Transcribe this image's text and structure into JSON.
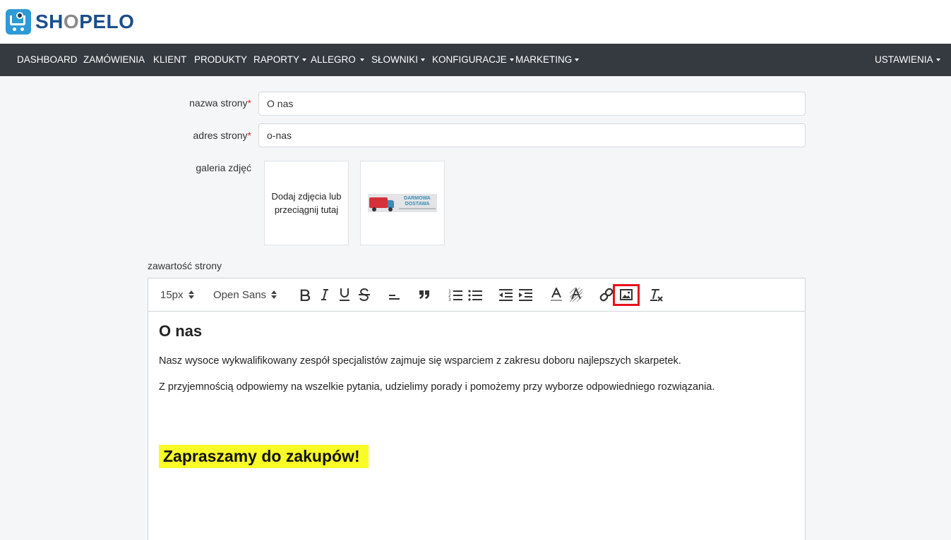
{
  "brand": {
    "name_pre": "SH",
    "name_o": "O",
    "name_post": "PELO"
  },
  "nav": {
    "items": [
      {
        "label": "DASHBOARD",
        "dropdown": false
      },
      {
        "label": "ZAMÓWIENIA",
        "dropdown": false
      },
      {
        "label": "KLIENT",
        "dropdown": false
      },
      {
        "label": "PRODUKTY",
        "dropdown": false
      },
      {
        "label": "RAPORTY",
        "dropdown": true
      },
      {
        "label": "ALLEGRO",
        "dropdown": true
      },
      {
        "label": "SŁOWNIKI",
        "dropdown": true
      },
      {
        "label": "KONFIGURACJE",
        "dropdown": true
      },
      {
        "label": "MARKETING",
        "dropdown": true
      }
    ],
    "settings": {
      "label": "USTAWIENIA",
      "dropdown": true
    }
  },
  "form": {
    "page_name": {
      "label": "nazwa strony",
      "required_mark": "*",
      "value": "O nas"
    },
    "page_address": {
      "label": "adres strony",
      "required_mark": "*",
      "value": "o-nas"
    },
    "gallery": {
      "label": "galeria zdjęć",
      "upload_text": "Dodaj zdjęcia lub przeciągnij tutaj",
      "image": {
        "title_line1": "DARMOWA",
        "title_line2": "DOSTAWA"
      }
    },
    "content_label": "zawartość strony"
  },
  "editor": {
    "toolbar": {
      "font_size": "15px",
      "font_family": "Open Sans",
      "buttons": [
        "bold",
        "italic",
        "underline",
        "strikethrough",
        "align",
        "blockquote",
        "ordered-list",
        "bullet-list",
        "outdent",
        "indent",
        "text-color",
        "background-color",
        "link",
        "image",
        "clear-formatting"
      ],
      "highlighted_button": "image"
    },
    "content": {
      "heading": "O nas",
      "paragraph1": "Nasz wysoce wykwalifikowany zespół specjalistów zajmuje się wsparciem z zakresu doboru najlepszych skarpetek.",
      "paragraph2": "Z przyjemnością odpowiemy na wszelkie pytania, udzielimy porady i pomożemy przy wyborze odpowiedniego rozwiązania.",
      "highlight_heading": "Zapraszamy do zakupów!",
      "highlight_color": "#f8fb26"
    }
  },
  "colors": {
    "navbar": "#353a40",
    "brand": "#1b4e8c",
    "logo_accent": "#2e9ad6",
    "required": "#d62b2b",
    "callout": "#e8101a"
  }
}
